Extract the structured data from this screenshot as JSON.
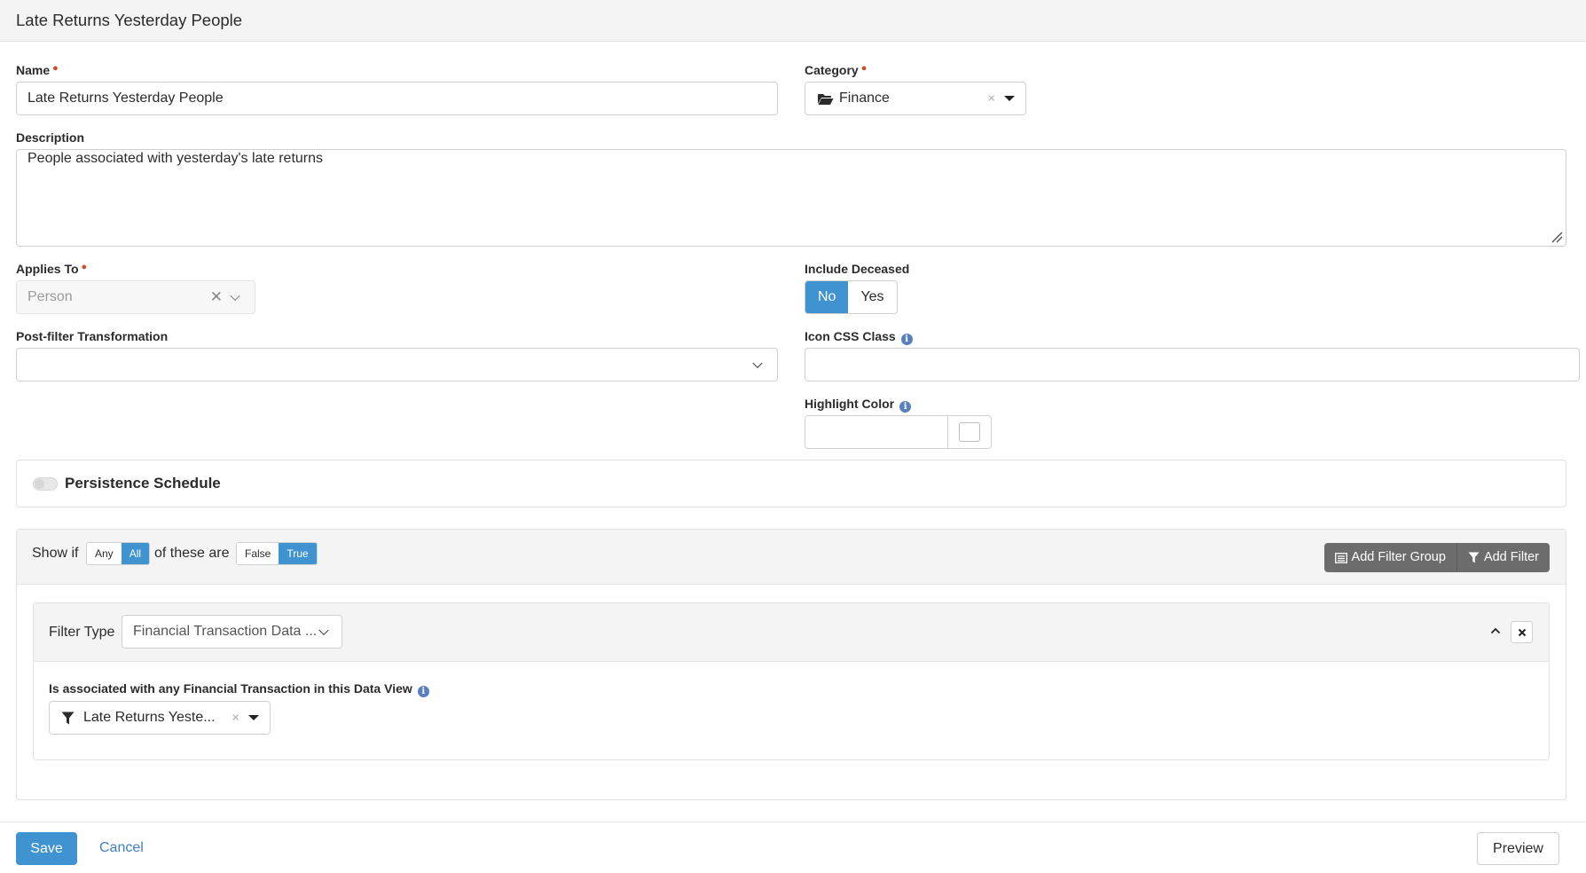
{
  "page": {
    "title": "Late Returns Yesterday People"
  },
  "form": {
    "name": {
      "label": "Name",
      "value": "Late Returns Yesterday People"
    },
    "category": {
      "label": "Category",
      "value": "Finance"
    },
    "description": {
      "label": "Description",
      "value": "People associated with yesterday's late returns"
    },
    "applies_to": {
      "label": "Applies To",
      "value": "Person"
    },
    "include_deceased": {
      "label": "Include Deceased",
      "options": [
        "No",
        "Yes"
      ],
      "selected": "No"
    },
    "post_filter": {
      "label": "Post-filter Transformation",
      "value": ""
    },
    "icon_css": {
      "label": "Icon CSS Class",
      "value": ""
    },
    "highlight_color": {
      "label": "Highlight Color",
      "value": ""
    },
    "persistence": {
      "label": "Persistence Schedule",
      "enabled": false
    }
  },
  "filters": {
    "show_if_label": "Show if",
    "any_all": {
      "options": [
        "Any",
        "All"
      ],
      "selected": "All"
    },
    "of_these_are_label": "of these are",
    "false_true": {
      "options": [
        "False",
        "True"
      ],
      "selected": "True"
    },
    "add_filter_group_label": "Add Filter Group",
    "add_filter_label": "Add Filter",
    "filter_item": {
      "type_label": "Filter Type",
      "type_value": "Financial Transaction Data ...",
      "field_label": "Is associated with any Financial Transaction in this Data View",
      "dataview_value": "Late Returns Yeste..."
    }
  },
  "footer": {
    "save_label": "Save",
    "cancel_label": "Cancel",
    "preview_label": "Preview"
  },
  "colors": {
    "primary": "#3e93d0",
    "required": "#d04a2a",
    "dark_button": "#6c6c6c",
    "link": "#3e7ec0"
  }
}
